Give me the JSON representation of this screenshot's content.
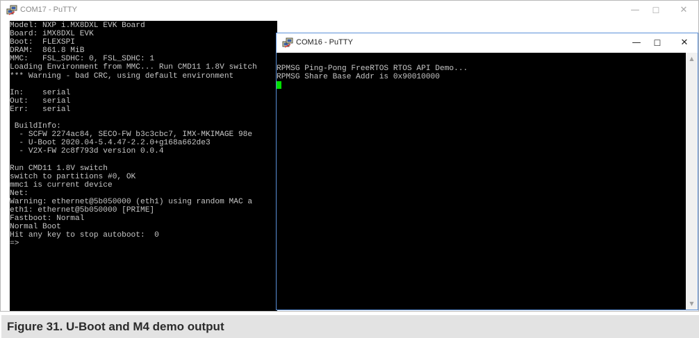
{
  "com17": {
    "title": "COM17 - PuTTY",
    "lines": [
      "Model: NXP i.MX8DXL EVK Board",
      "Board: iMX8DXL EVK",
      "Boot:  FLEXSPI",
      "DRAM:  861.8 MiB",
      "MMC:   FSL_SDHC: 0, FSL_SDHC: 1",
      "Loading Environment from MMC... Run CMD11 1.8V switch",
      "*** Warning - bad CRC, using default environment",
      "",
      "In:    serial",
      "Out:   serial",
      "Err:   serial",
      "",
      " BuildInfo:",
      "  - SCFW 2274ac84, SECO-FW b3c3cbc7, IMX-MKIMAGE 98e",
      "  - U-Boot 2020.04-5.4.47-2.2.0+g168a662de3",
      "  - V2X-FW 2c8f793d version 0.0.4",
      "",
      "Run CMD11 1.8V switch",
      "switch to partitions #0, OK",
      "mmc1 is current device",
      "Net:",
      "Warning: ethernet@5b050000 (eth1) using random MAC a",
      "eth1: ethernet@5b050000 [PRIME]",
      "Fastboot: Normal",
      "Normal Boot",
      "Hit any key to stop autoboot:  0",
      "=>"
    ]
  },
  "com16": {
    "title": "COM16 - PuTTY",
    "lines": [
      "RPMSG Ping-Pong FreeRTOS RTOS API Demo...",
      "RPMSG Share Base Addr is 0x90010000"
    ]
  },
  "window_controls": {
    "minimize": "—",
    "maximize": "☐",
    "close": "✕"
  },
  "caption": "Figure 31.  U-Boot and M4 demo output",
  "colors": {
    "terminal_bg": "#000000",
    "terminal_text": "#c7c7c7",
    "cursor": "#00e000",
    "caption_bg": "#e3e3e3"
  }
}
